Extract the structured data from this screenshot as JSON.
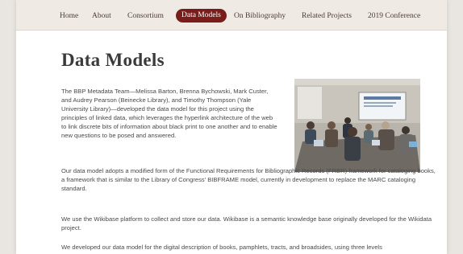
{
  "nav": {
    "items": [
      {
        "label": "Home"
      },
      {
        "label": "About"
      },
      {
        "label": "Consortium"
      },
      {
        "label": "Data Models"
      },
      {
        "label": "On Bibliography"
      },
      {
        "label": "Related Projects"
      },
      {
        "label": "2019 Conference"
      }
    ],
    "active": "Data Models",
    "active_color": "#7a1d1a"
  },
  "page": {
    "title": "Data Models",
    "paragraphs": [
      "The BBP Metadata Team—Melissa Barton, Brenna Bychowski, Mark Custer, and Audrey Pearson (Beinecke Library), and Timothy Thompson (Yale University Library)—developed the data model for this project using the principles of linked data, which leverages the hyperlink architecture of the web to link discrete bits of information about black print to one another and to enable new questions to be posed and answered.",
      "Our data model adopts a modified form of the Functional Requirements for Bibliographic Records (FRBR) framework for cataloging books, a framework that is similar to the Library of Congress' BIBFRAME model, currently in development to replace the MARC cataloging standard.",
      "We use the Wikibase platform to collect and store our data. Wikibase is a semantic knowledge base originally developed for the Wikidata project.",
      "We developed our data model for the digital description of books, pamphlets, tracts, and broadsides, using three levels"
    ]
  }
}
